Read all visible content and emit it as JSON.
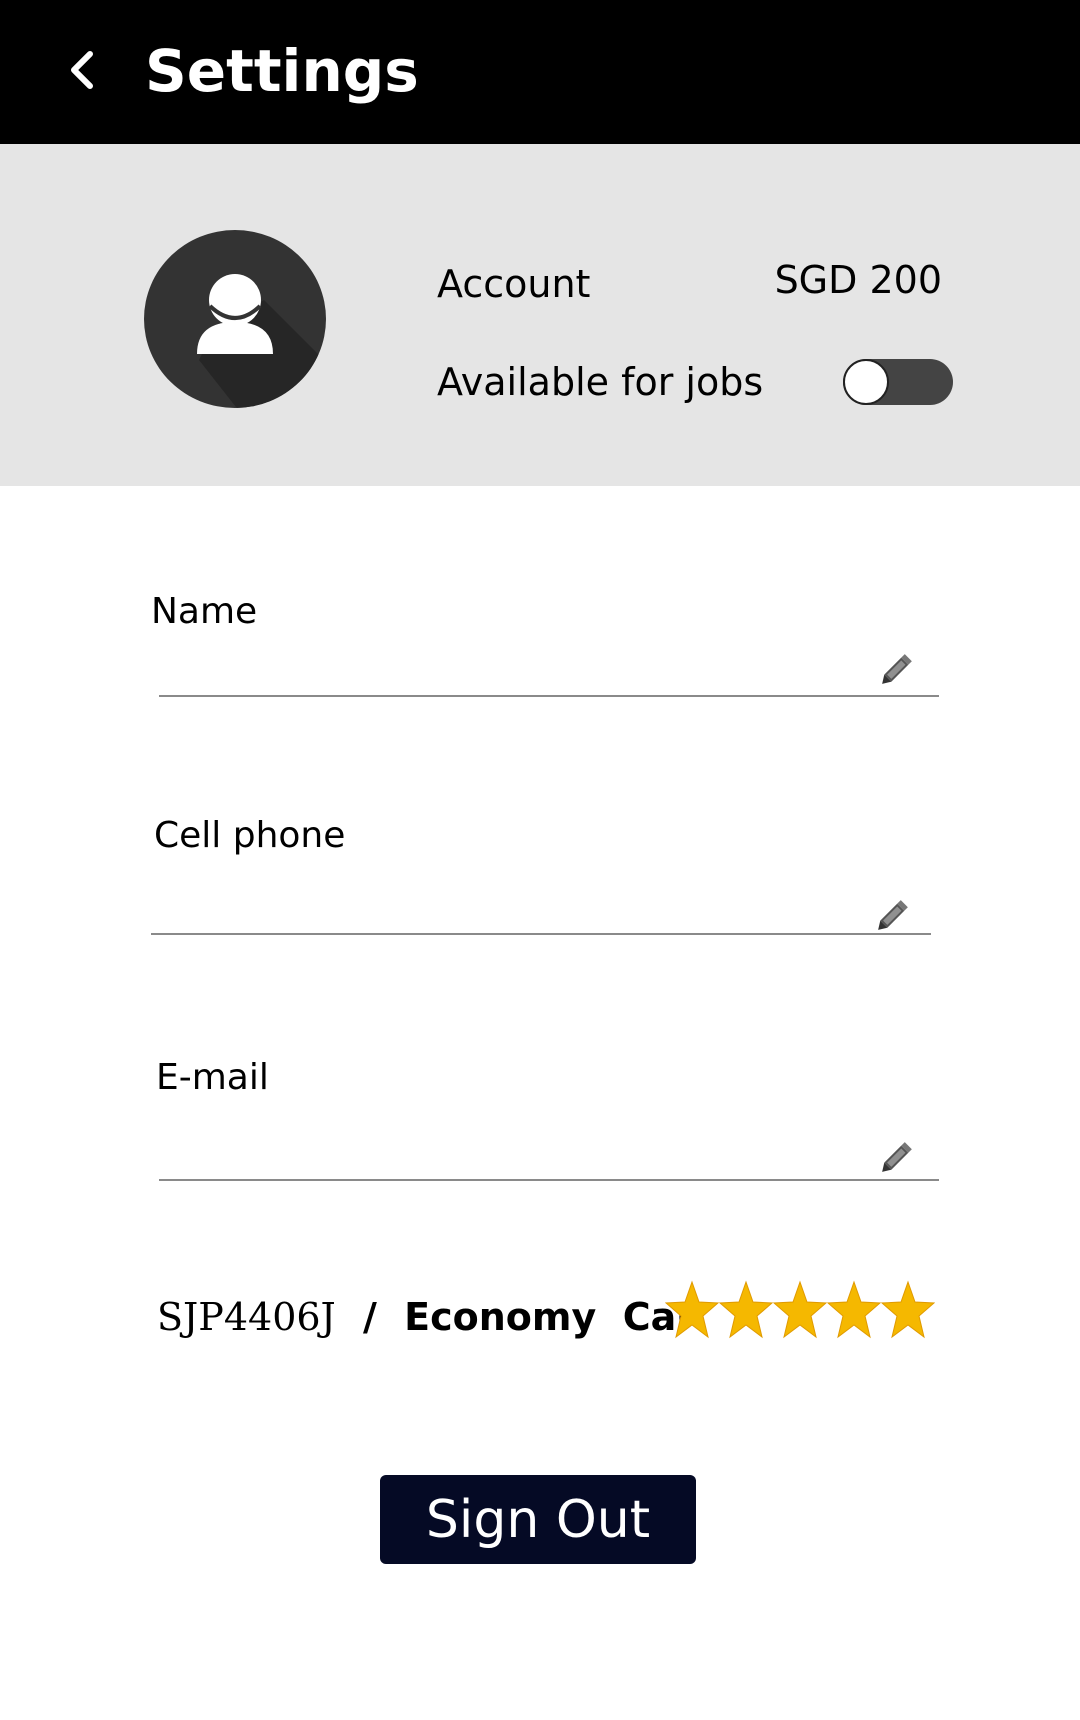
{
  "header": {
    "title": "Settings",
    "back_icon": "chevron-left-icon"
  },
  "profile": {
    "avatar_icon": "user-avatar-icon",
    "account_label": "Account",
    "account_value": "SGD 200",
    "available_label": "Available for jobs",
    "available_on": false
  },
  "fields": {
    "name": {
      "label": "Name",
      "value": ""
    },
    "phone": {
      "label": "Cell phone",
      "value": ""
    },
    "email": {
      "label": "E-mail",
      "value": ""
    },
    "edit_icon": "pencil-icon"
  },
  "vehicle": {
    "plate": "SJP4406J",
    "separator": "/",
    "type": "Economy  Car",
    "rating": 5,
    "rating_max": 5,
    "star_color": "#f5b800"
  },
  "actions": {
    "sign_out": "Sign Out"
  },
  "colors": {
    "appbar": "#000000",
    "profile_bg": "#e5e5e5",
    "button_bg": "#050a25"
  }
}
